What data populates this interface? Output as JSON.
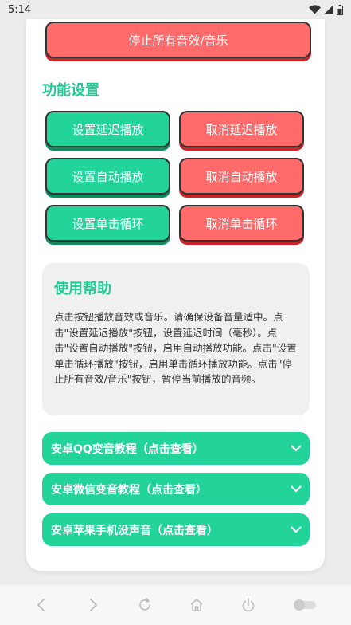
{
  "status": {
    "time": "5:14"
  },
  "stop_button": "停止所有音效/音乐",
  "section_title": "功能设置",
  "buttons": {
    "set_delay": "设置延迟播放",
    "cancel_delay": "取消延迟播放",
    "set_auto": "设置自动播放",
    "cancel_auto": "取消自动播放",
    "set_loop": "设置单击循环",
    "cancel_loop": "取消单击循环"
  },
  "help": {
    "title": "使用帮助",
    "text": "点击按钮播放音效或音乐。请确保设备音量适中。点击\"设置延迟播放\"按钮，设置延迟时间（毫秒）。点击\"设置自动播放\"按钮，启用自动播放功能。点击\"设置单击循环播放\"按钮，启用单击循环播放功能。点击\"停止所有音效/音乐\"按钮，暂停当前播放的音频。"
  },
  "accordions": [
    "安卓QQ变音教程（点击查看）",
    "安卓微信变音教程（点击查看）",
    "安卓苹果手机没声音（点击查看）"
  ],
  "colors": {
    "green": "#23d49a",
    "red": "#ff6b6b",
    "title_green": "#23c996"
  },
  "icons": [
    "wifi-icon",
    "signal-icon",
    "battery-icon",
    "back-icon",
    "forward-icon",
    "refresh-icon",
    "home-icon",
    "power-icon",
    "toggle-icon"
  ]
}
